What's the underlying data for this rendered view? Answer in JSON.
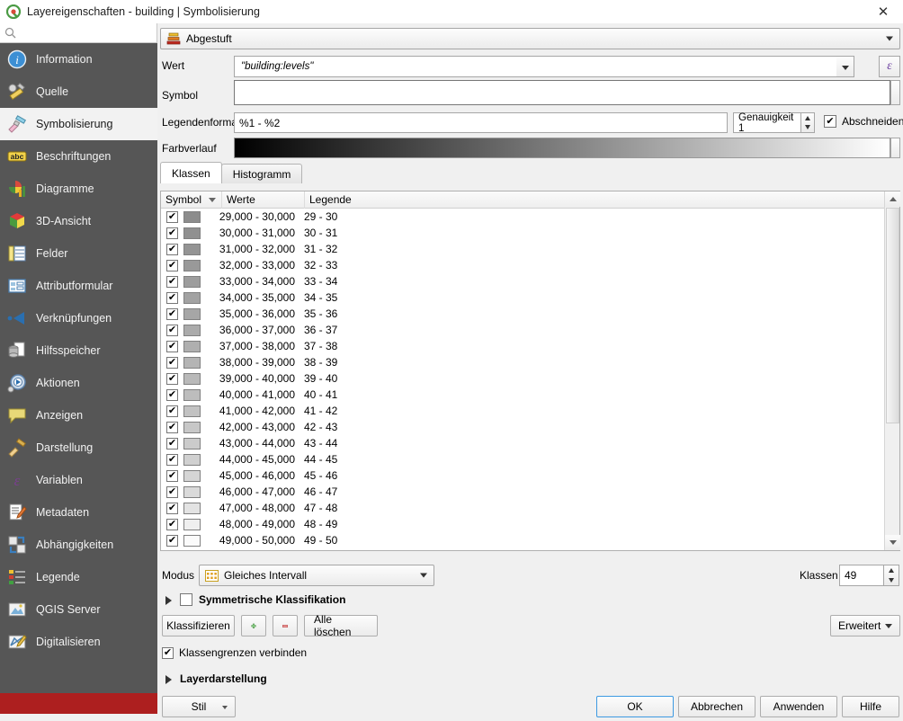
{
  "window": {
    "title": "Layereigenschaften - building | Symbolisierung",
    "app_icon": "qgis-icon",
    "close_label": "✕"
  },
  "sidebar": {
    "search": {
      "placeholder": "",
      "value": "",
      "icon": "search-icon"
    },
    "items": [
      {
        "label": "Information",
        "icon": "info-icon",
        "active": false
      },
      {
        "label": "Quelle",
        "icon": "source-wrench-icon",
        "active": false
      },
      {
        "label": "Symbolisierung",
        "icon": "paintbrush-icon",
        "active": true
      },
      {
        "label": "Beschriftungen",
        "icon": "abc-label-icon",
        "active": false
      },
      {
        "label": "Diagramme",
        "icon": "charts-icon",
        "active": false
      },
      {
        "label": "3D-Ansicht",
        "icon": "cube-3d-icon",
        "active": false
      },
      {
        "label": "Felder",
        "icon": "fields-table-icon",
        "active": false
      },
      {
        "label": "Attributformular",
        "icon": "attribute-form-icon",
        "active": false
      },
      {
        "label": "Verknüpfungen",
        "icon": "joins-icon",
        "active": false
      },
      {
        "label": "Hilfsspeicher",
        "icon": "auxiliary-storage-icon",
        "active": false
      },
      {
        "label": "Aktionen",
        "icon": "actions-gear-icon",
        "active": false
      },
      {
        "label": "Anzeigen",
        "icon": "display-balloon-icon",
        "active": false
      },
      {
        "label": "Darstellung",
        "icon": "rendering-brush-icon",
        "active": false
      },
      {
        "label": "Variablen",
        "icon": "epsilon-variables-icon",
        "active": false
      },
      {
        "label": "Metadaten",
        "icon": "metadata-pencil-icon",
        "active": false
      },
      {
        "label": "Abhängigkeiten",
        "icon": "dependencies-icon",
        "active": false
      },
      {
        "label": "Legende",
        "icon": "legend-icon",
        "active": false
      },
      {
        "label": "QGIS Server",
        "icon": "qgis-server-icon",
        "active": false
      },
      {
        "label": "Digitalisieren",
        "icon": "digitizing-icon",
        "active": false
      }
    ]
  },
  "renderer": {
    "selected": "Abgestuft",
    "icon": "graduated-renderer-icon"
  },
  "fields": {
    "wert_label": "Wert",
    "wert_value": "\"building:levels\"",
    "expression_button": "ε",
    "symbol_label": "Symbol",
    "symbol_value": "",
    "legendenformat_label": "Legendenformat",
    "legendenformat_value": "%1 - %2",
    "precision_value": "Genauigkeit 1",
    "trim_label": "Abschneiden",
    "trim_checked": true,
    "farbverlauf_label": "Farbverlauf",
    "ramp_start_color": "#000000",
    "ramp_end_color": "#ffffff"
  },
  "tabs": [
    {
      "label": "Klassen",
      "selected": true
    },
    {
      "label": "Histogramm",
      "selected": false
    }
  ],
  "table": {
    "columns": [
      "Symbol",
      "Werte",
      "Legende"
    ],
    "rows": [
      {
        "checked": true,
        "color": "#8c8c8c",
        "werte": "29,000 - 30,000",
        "legende": "29 - 30"
      },
      {
        "checked": true,
        "color": "#909090",
        "werte": "30,000 - 31,000",
        "legende": "30 - 31"
      },
      {
        "checked": true,
        "color": "#949494",
        "werte": "31,000 - 32,000",
        "legende": "31 - 32"
      },
      {
        "checked": true,
        "color": "#999999",
        "werte": "32,000 - 33,000",
        "legende": "32 - 33"
      },
      {
        "checked": true,
        "color": "#9d9d9d",
        "werte": "33,000 - 34,000",
        "legende": "33 - 34"
      },
      {
        "checked": true,
        "color": "#a2a2a2",
        "werte": "34,000 - 35,000",
        "legende": "34 - 35"
      },
      {
        "checked": true,
        "color": "#a6a6a6",
        "werte": "35,000 - 36,000",
        "legende": "35 - 36"
      },
      {
        "checked": true,
        "color": "#ababab",
        "werte": "36,000 - 37,000",
        "legende": "36 - 37"
      },
      {
        "checked": true,
        "color": "#afafaf",
        "werte": "37,000 - 38,000",
        "legende": "37 - 38"
      },
      {
        "checked": true,
        "color": "#b4b4b4",
        "werte": "38,000 - 39,000",
        "legende": "38 - 39"
      },
      {
        "checked": true,
        "color": "#b9b9b9",
        "werte": "39,000 - 40,000",
        "legende": "39 - 40"
      },
      {
        "checked": true,
        "color": "#bdbdbd",
        "werte": "40,000 - 41,000",
        "legende": "40 - 41"
      },
      {
        "checked": true,
        "color": "#c2c2c2",
        "werte": "41,000 - 42,000",
        "legende": "41 - 42"
      },
      {
        "checked": true,
        "color": "#c7c7c7",
        "werte": "42,000 - 43,000",
        "legende": "42 - 43"
      },
      {
        "checked": true,
        "color": "#cbcbcb",
        "werte": "43,000 - 44,000",
        "legende": "43 - 44"
      },
      {
        "checked": true,
        "color": "#d0d0d0",
        "werte": "44,000 - 45,000",
        "legende": "44 - 45"
      },
      {
        "checked": true,
        "color": "#d5d5d5",
        "werte": "45,000 - 46,000",
        "legende": "45 - 46"
      },
      {
        "checked": true,
        "color": "#dadada",
        "werte": "46,000 - 47,000",
        "legende": "46 - 47"
      },
      {
        "checked": true,
        "color": "#e3e3e3",
        "werte": "47,000 - 48,000",
        "legende": "47 - 48"
      },
      {
        "checked": true,
        "color": "#efefef",
        "werte": "48,000 - 49,000",
        "legende": "48 - 49"
      },
      {
        "checked": true,
        "color": "#fbfbfb",
        "werte": "49,000 - 50,000",
        "legende": "49 - 50"
      }
    ],
    "checkmark": "✔"
  },
  "controls": {
    "modus_label": "Modus",
    "modus_value": "Gleiches Intervall",
    "modus_icon": "equal-interval-icon",
    "klassen_label": "Klassen",
    "klassen_value": "49",
    "symmetric_label": "Symmetrische Klassifikation",
    "symmetric_checked": false,
    "classify_button": "Klassifizieren",
    "add_button": "+",
    "delete_button": "−",
    "clear_button": "Alle löschen",
    "advanced_button": "Erweitert",
    "link_boundaries_label": "Klassengrenzen verbinden",
    "link_boundaries_checked": true,
    "layer_rendering_label": "Layerdarstellung"
  },
  "footer": {
    "style_button": "Stil",
    "ok_button": "OK",
    "cancel_button": "Abbrechen",
    "apply_button": "Anwenden",
    "help_button": "Hilfe"
  }
}
